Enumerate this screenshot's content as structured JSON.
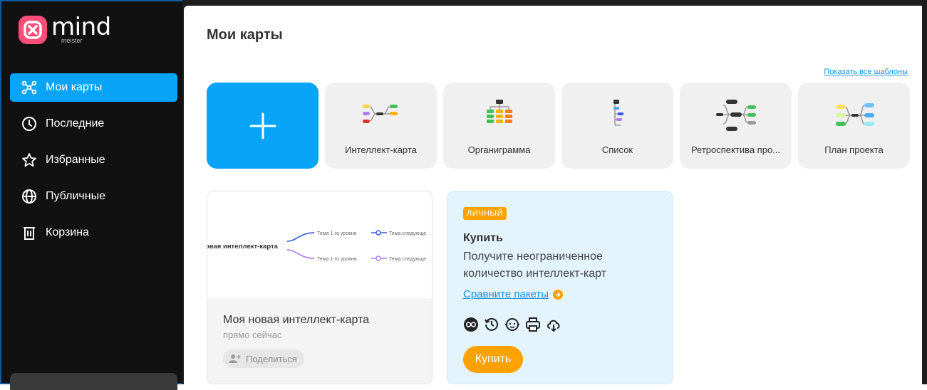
{
  "app": {
    "logo_text": "mind",
    "logo_sub": "meister"
  },
  "sidebar": {
    "items": [
      {
        "label": "Мои карты",
        "icon": "mindmap-icon",
        "active": true
      },
      {
        "label": "Последние",
        "icon": "clock-icon",
        "active": false
      },
      {
        "label": "Избранные",
        "icon": "star-icon",
        "active": false
      },
      {
        "label": "Публичные",
        "icon": "globe-icon",
        "active": false
      },
      {
        "label": "Корзина",
        "icon": "trash-icon",
        "active": false
      }
    ]
  },
  "main": {
    "title": "Мои карты",
    "all_templates_link": "Показать все шаблоны",
    "templates": [
      {
        "label": "",
        "icon": "plus-icon"
      },
      {
        "label": "Интеллект-карта",
        "icon": "mindmap-template-icon"
      },
      {
        "label": "Органиграмма",
        "icon": "orgchart-template-icon"
      },
      {
        "label": "Список",
        "icon": "list-template-icon"
      },
      {
        "label": "Ретроспектива про...",
        "icon": "retrospective-template-icon"
      },
      {
        "label": "План проекта",
        "icon": "project-plan-template-icon"
      }
    ],
    "map_card": {
      "preview_root": "овая интеллект-карта",
      "preview_topic1": "Тема 1-го уровня",
      "preview_topic2": "Тема следующе",
      "preview_topic3": "Тема 1-го уровня",
      "preview_topic4": "Тема следующе",
      "name": "Моя новая интеллект-карта",
      "time": "прямо сейчас",
      "share_label": "Поделиться"
    },
    "promo": {
      "badge": "ЛИЧНЫЙ",
      "title": "Купить",
      "description": "Получите неограниченное количество интеллект-карт",
      "compare_link": "Сравните пакеты",
      "features": [
        "infinity-icon",
        "history-icon",
        "support-icon",
        "print-icon",
        "cloud-download-icon"
      ],
      "buy_label": "Купить"
    }
  },
  "colors": {
    "accent": "#07a4f7",
    "orange": "#ffa200",
    "sidebar_bg": "#111111",
    "logo": "#ff4d7a"
  }
}
